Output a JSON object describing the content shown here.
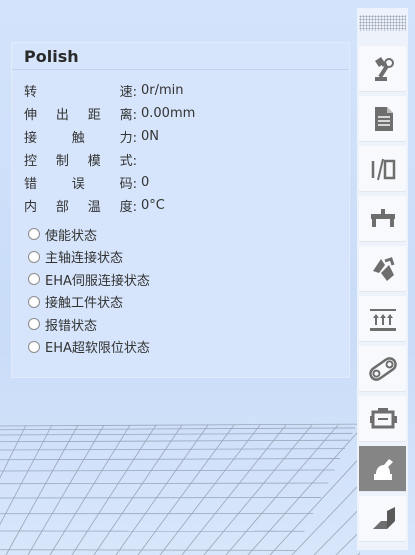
{
  "panel": {
    "title": "Polish",
    "props": [
      {
        "label_chars": [
          "转",
          "速:"
        ],
        "value": "0r/min"
      },
      {
        "label_chars": [
          "伸",
          "出",
          "距",
          "离:"
        ],
        "value": "0.00mm"
      },
      {
        "label_chars": [
          "接",
          "触",
          "力:"
        ],
        "value": "0N"
      },
      {
        "label_chars": [
          "控",
          "制",
          "模",
          "式:"
        ],
        "value": ""
      },
      {
        "label_chars": [
          "错",
          "误",
          "码:"
        ],
        "value": "0"
      },
      {
        "label_chars": [
          "内",
          "部",
          "温",
          "度:"
        ],
        "value": "0°C"
      }
    ],
    "status_items": [
      {
        "label": "使能状态",
        "checked": false
      },
      {
        "label": "主轴连接状态",
        "checked": false
      },
      {
        "label": "EHA伺服连接状态",
        "checked": false
      },
      {
        "label": "接触工件状态",
        "checked": false
      },
      {
        "label": "报错状态",
        "checked": false
      },
      {
        "label": "EHA超软限位状态",
        "checked": false
      }
    ]
  },
  "toolbar": {
    "buttons": [
      {
        "icon": "robot-arm-icon",
        "active": false
      },
      {
        "icon": "document-icon",
        "active": false
      },
      {
        "icon": "io-icon",
        "active": false
      },
      {
        "icon": "tool-bracket-icon",
        "active": false
      },
      {
        "icon": "gripper-icon",
        "active": false
      },
      {
        "icon": "lift-arrows-icon",
        "active": false
      },
      {
        "icon": "conveyor-belt-icon",
        "active": false
      },
      {
        "icon": "motor-icon",
        "active": false
      },
      {
        "icon": "polish-tool-icon",
        "active": true
      },
      {
        "icon": "corner-plane-icon",
        "active": false
      }
    ]
  },
  "colors": {
    "background": "#cfe0fa",
    "panel": "#d6e5fb",
    "toolbar": "#eef3fb",
    "active_button": "#858585",
    "icon": "#6e6e6e"
  }
}
